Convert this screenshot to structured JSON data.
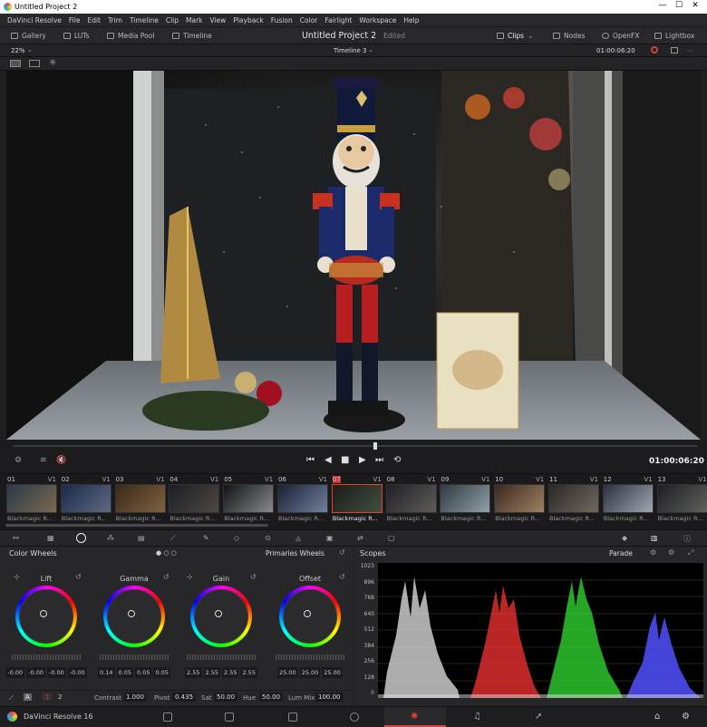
{
  "window": {
    "title": "Untitled Project 2",
    "min": "—",
    "max": "☐",
    "close": "✕"
  },
  "menu": [
    "DaVinci Resolve",
    "File",
    "Edit",
    "Trim",
    "Timeline",
    "Clip",
    "Mark",
    "View",
    "Playback",
    "Fusion",
    "Color",
    "Fairlight",
    "Workspace",
    "Help"
  ],
  "toolbar": {
    "gallery": "Gallery",
    "luts": "LUTs",
    "media_pool": "Media Pool",
    "timeline": "Timeline",
    "project_title": "Untitled Project 2",
    "edited": "Edited",
    "clips": "Clips",
    "nodes": "Nodes",
    "openfx": "OpenFX",
    "lightbox": "Lightbox"
  },
  "viewer": {
    "zoom": "22%",
    "timeline_name": "Timeline 3",
    "timecode_top": "01:00:06:20",
    "timecode": "01:00:06:20"
  },
  "clips": [
    {
      "num": "01",
      "track": "V1",
      "label": "Blackmagic R...",
      "sel": false,
      "c1": "#2a3a48",
      "c2": "#7a6a50"
    },
    {
      "num": "02",
      "track": "V1",
      "label": "Blackmagic R...",
      "sel": false,
      "c1": "#1a2a4a",
      "c2": "#606a80"
    },
    {
      "num": "03",
      "track": "V1",
      "label": "Blackmagic R...",
      "sel": false,
      "c1": "#3a2a1a",
      "c2": "#806040"
    },
    {
      "num": "04",
      "track": "V1",
      "label": "Blackmagic R...",
      "sel": false,
      "c1": "#1a1e26",
      "c2": "#504840"
    },
    {
      "num": "05",
      "track": "V1",
      "label": "Blackmagic R...",
      "sel": false,
      "c1": "#101418",
      "c2": "#888a8c"
    },
    {
      "num": "06",
      "track": "V1",
      "label": "Blackmagic R...",
      "sel": false,
      "c1": "#1a2030",
      "c2": "#7080a0"
    },
    {
      "num": "07",
      "track": "V1",
      "label": "Blackmagic R...",
      "sel": true,
      "c1": "#1a1c18",
      "c2": "#405040"
    },
    {
      "num": "08",
      "track": "V1",
      "label": "Blackmagic R...",
      "sel": false,
      "c1": "#202026",
      "c2": "#605c58"
    },
    {
      "num": "09",
      "track": "V1",
      "label": "Blackmagic R...",
      "sel": false,
      "c1": "#303a40",
      "c2": "#90a0a8"
    },
    {
      "num": "10",
      "track": "V1",
      "label": "Blackmagic R...",
      "sel": false,
      "c1": "#3a2a20",
      "c2": "#a08060"
    },
    {
      "num": "11",
      "track": "V1",
      "label": "Blackmagic R...",
      "sel": false,
      "c1": "#2a2826",
      "c2": "#706860"
    },
    {
      "num": "12",
      "track": "V1",
      "label": "Blackmagic R...",
      "sel": false,
      "c1": "#2a3040",
      "c2": "#a0a8b0"
    },
    {
      "num": "13",
      "track": "V1",
      "label": "Blackmagic R...",
      "sel": false,
      "c1": "#1c1e22",
      "c2": "#60605c"
    }
  ],
  "color_wheels": {
    "title": "Color Wheels",
    "mode": "Primaries Wheels",
    "wheels": [
      {
        "label": "Lift",
        "values": [
          "-0.00",
          "-0.00",
          "-0.00",
          "-0.00"
        ]
      },
      {
        "label": "Gamma",
        "values": [
          "0.14",
          "0.05",
          "0.05",
          "0.05"
        ]
      },
      {
        "label": "Gain",
        "values": [
          "2.55",
          "2.55",
          "2.55",
          "2.55"
        ]
      },
      {
        "label": "Offset",
        "values": [
          "25.00",
          "25.00",
          "25.00"
        ]
      }
    ],
    "params": {
      "page1": "1",
      "page2": "2",
      "contrast_label": "Contrast",
      "contrast": "1.000",
      "pivot_label": "Pivot",
      "pivot": "0.435",
      "sat_label": "Sat",
      "sat": "50.00",
      "hue_label": "Hue",
      "hue": "50.00",
      "lummix_label": "Lum Mix",
      "lummix": "100.00"
    }
  },
  "scopes": {
    "title": "Scopes",
    "mode": "Parade",
    "ticks": [
      "1023",
      "896",
      "768",
      "640",
      "512",
      "384",
      "256",
      "128",
      "0"
    ]
  },
  "footer": {
    "app": "DaVinci Resolve 16"
  },
  "colors": {
    "accent_red": "#e04030",
    "selected_page": "#e0403a"
  }
}
